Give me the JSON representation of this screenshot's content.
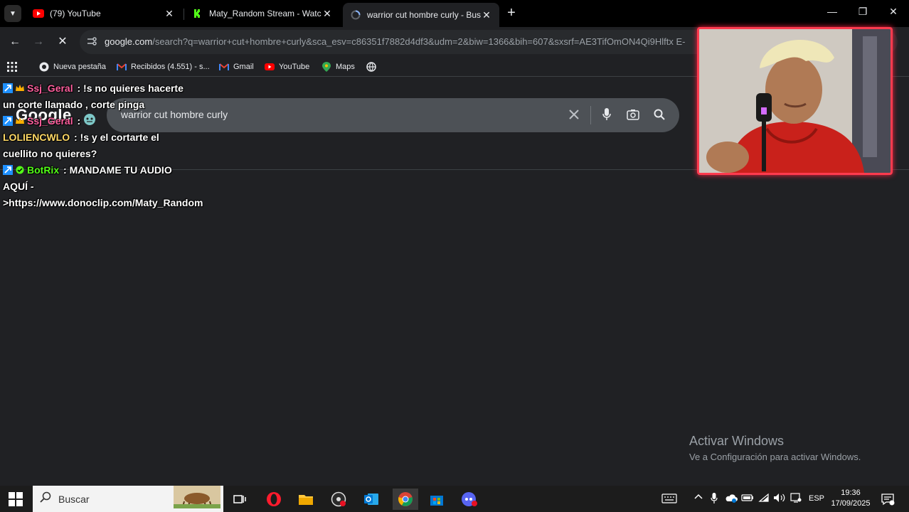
{
  "tabs": [
    {
      "title": "(79) YouTube",
      "favicon": "youtube-icon"
    },
    {
      "title": "Maty_Random Stream - Watch",
      "favicon": "kick-icon"
    },
    {
      "title": "warrior cut hombre curly - Busc",
      "favicon": "loading-icon",
      "active": true
    }
  ],
  "toolbar": {
    "url_host": "google.com",
    "url_path": "/search?q=warrior+cut+hombre+curly&sca_esv=c86351f7882d4df3&udm=2&biw=1366&bih=607&sxsrf=AE3TifOmON4Qi9Hlftx E-"
  },
  "bookmarks": [
    {
      "label": "Nueva pestaña",
      "icon": "chrome-icon"
    },
    {
      "label": "Recibidos (4.551) - s...",
      "icon": "gmail-icon"
    },
    {
      "label": "Gmail",
      "icon": "gmail-icon"
    },
    {
      "label": "YouTube",
      "icon": "youtube-icon"
    },
    {
      "label": "Maps",
      "icon": "maps-icon"
    }
  ],
  "google": {
    "logo": "Google",
    "query": "warrior cut hombre curly"
  },
  "chat": [
    {
      "user": "Ssj_Geral",
      "user_color": "#ff5f9e",
      "text": " : !s no quieres hacerte un corte llamado , corte pinga"
    },
    {
      "user": "Ssj_Geral",
      "user_color": "#ff5f9e",
      "text": " :"
    },
    {
      "user": "LOLIENCWLO",
      "user_color": "#ffd966",
      "text": " : !s y el cortarte el cuellito no quieres?"
    },
    {
      "user": "BotRix",
      "user_color": "#53fc18",
      "text": " : MANDAME TU AUDIO AQUÍ - >https://www.donoclip.com/Maty_Random"
    }
  ],
  "watermark": {
    "title": "Activar Windows",
    "subtitle": "Ve a Configuración para activar Windows."
  },
  "taskbar": {
    "search_label": "Buscar",
    "lang": "ESP",
    "time": "19:36",
    "date": "17/09/2025"
  },
  "colors": {
    "accent_red": "#ff3b4e",
    "kick_green": "#53fc18",
    "youtube_red": "#ff0000"
  }
}
